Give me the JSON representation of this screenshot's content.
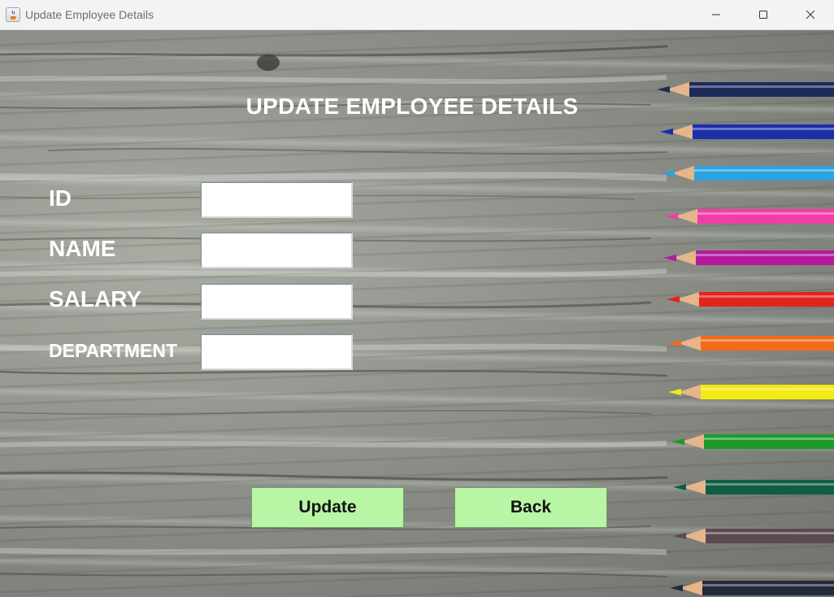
{
  "window": {
    "title": "Update Employee Details",
    "controls": [
      "minimize",
      "maximize",
      "close"
    ]
  },
  "form": {
    "heading": "UPDATE EMPLOYEE DETAILS",
    "fields": [
      {
        "label": "ID",
        "value": ""
      },
      {
        "label": "NAME",
        "value": ""
      },
      {
        "label": "SALARY",
        "value": ""
      },
      {
        "label": "DEPARTMENT",
        "value": ""
      }
    ]
  },
  "buttons": {
    "update": "Update",
    "back": "Back"
  },
  "colors": {
    "button_bg": "#b8f5a4",
    "label_text": "#ffffff",
    "background_wood": "#8d9189"
  },
  "decor": {
    "pencil_colors": [
      "#1d2a5a",
      "#1a2fa8",
      "#2aa3e0",
      "#f23ca8",
      "#b4199e",
      "#e4221e",
      "#f26b1c",
      "#f3ea12",
      "#1e9a2a",
      "#0f5e44",
      "#5a4a4f",
      "#232a3a"
    ]
  }
}
